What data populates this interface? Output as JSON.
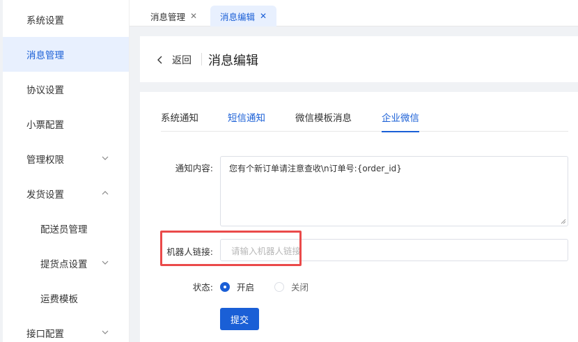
{
  "sidebar": {
    "items": [
      {
        "label": "系统设置"
      },
      {
        "label": "消息管理"
      },
      {
        "label": "协议设置"
      },
      {
        "label": "小票配置"
      },
      {
        "label": "管理权限"
      },
      {
        "label": "发货设置"
      },
      {
        "label": "配送员管理"
      },
      {
        "label": "提货点设置"
      },
      {
        "label": "运费模板"
      },
      {
        "label": "接口配置"
      }
    ]
  },
  "tabs": [
    {
      "label": "消息管理",
      "close": "✕"
    },
    {
      "label": "消息编辑",
      "close": "✕"
    }
  ],
  "header": {
    "back_label": "返回",
    "title": "消息编辑"
  },
  "channel_tabs": [
    {
      "label": "系统通知"
    },
    {
      "label": "短信通知"
    },
    {
      "label": "微信模板消息"
    },
    {
      "label": "企业微信"
    }
  ],
  "form": {
    "content_label": "通知内容:",
    "content_value": "您有个新订单请注意查收\\n订单号:{order_id}",
    "robot_label": "机器人链接:",
    "robot_placeholder": "请输入机器人链接",
    "status_label": "状态:",
    "status_on": "开启",
    "status_off": "关闭",
    "submit_label": "提交"
  },
  "colors": {
    "accent": "#1a5fd6",
    "highlight": "#ea4a4a"
  }
}
